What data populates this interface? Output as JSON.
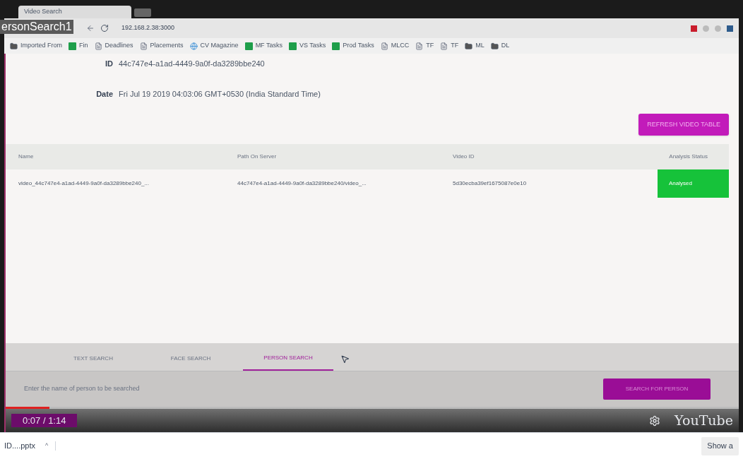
{
  "browser": {
    "tab_title": "Video Search",
    "url": "192.168.2.38:3000",
    "video_title": "ersonSearch1",
    "bookmarks": [
      {
        "label": "Imported From",
        "kind": "folder"
      },
      {
        "label": "Fin",
        "kind": "sheet"
      },
      {
        "label": "Deadlines",
        "kind": "page"
      },
      {
        "label": "Placements",
        "kind": "page"
      },
      {
        "label": "CV Magazine",
        "kind": "globe"
      },
      {
        "label": "MF Tasks",
        "kind": "sheet"
      },
      {
        "label": "VS Tasks",
        "kind": "sheet"
      },
      {
        "label": "Prod Tasks",
        "kind": "sheet"
      },
      {
        "label": "MLCC",
        "kind": "page"
      },
      {
        "label": "TF",
        "kind": "page"
      },
      {
        "label": "TF",
        "kind": "page"
      },
      {
        "label": "ML",
        "kind": "folder"
      },
      {
        "label": "DL",
        "kind": "folder"
      }
    ]
  },
  "details": [
    {
      "label": "ID",
      "value": "44c747e4-a1ad-4449-9a0f-da3289bbe240"
    },
    {
      "label": "Date",
      "value": "Fri Jul 19 2019 04:03:06 GMT+0530 (India Standard Time)"
    }
  ],
  "refresh_button": "REFRESH VIDEO TABLE",
  "table": {
    "columns": [
      "Name",
      "Path On Server",
      "Video ID",
      "Analysis Status"
    ],
    "rows": [
      {
        "cells": [
          "video_44c747e4-a1ad-4449-9a0f-da3289bbe240_...",
          "44c747e4-a1ad-4449-9a0f-da3289bbe240/video_...",
          "5d30ecba39ef1675087e0e10",
          "Analysed"
        ],
        "color": "#16c23a"
      }
    ]
  },
  "search_tabs": [
    {
      "label": "TEXT SEARCH",
      "selected": false
    },
    {
      "label": "FACE SEARCH",
      "selected": false
    },
    {
      "label": "PERSON SEARCH",
      "selected": true
    }
  ],
  "search": {
    "placeholder": "Enter the name of person to be searched",
    "button": "SEARCH FOR PERSON"
  },
  "player": {
    "time": "0:07 / 1:14",
    "level": 0.06,
    "logo": "YouTube"
  },
  "downloads": {
    "file": "ID....pptx",
    "caret": "^",
    "show_all": "Show a"
  }
}
